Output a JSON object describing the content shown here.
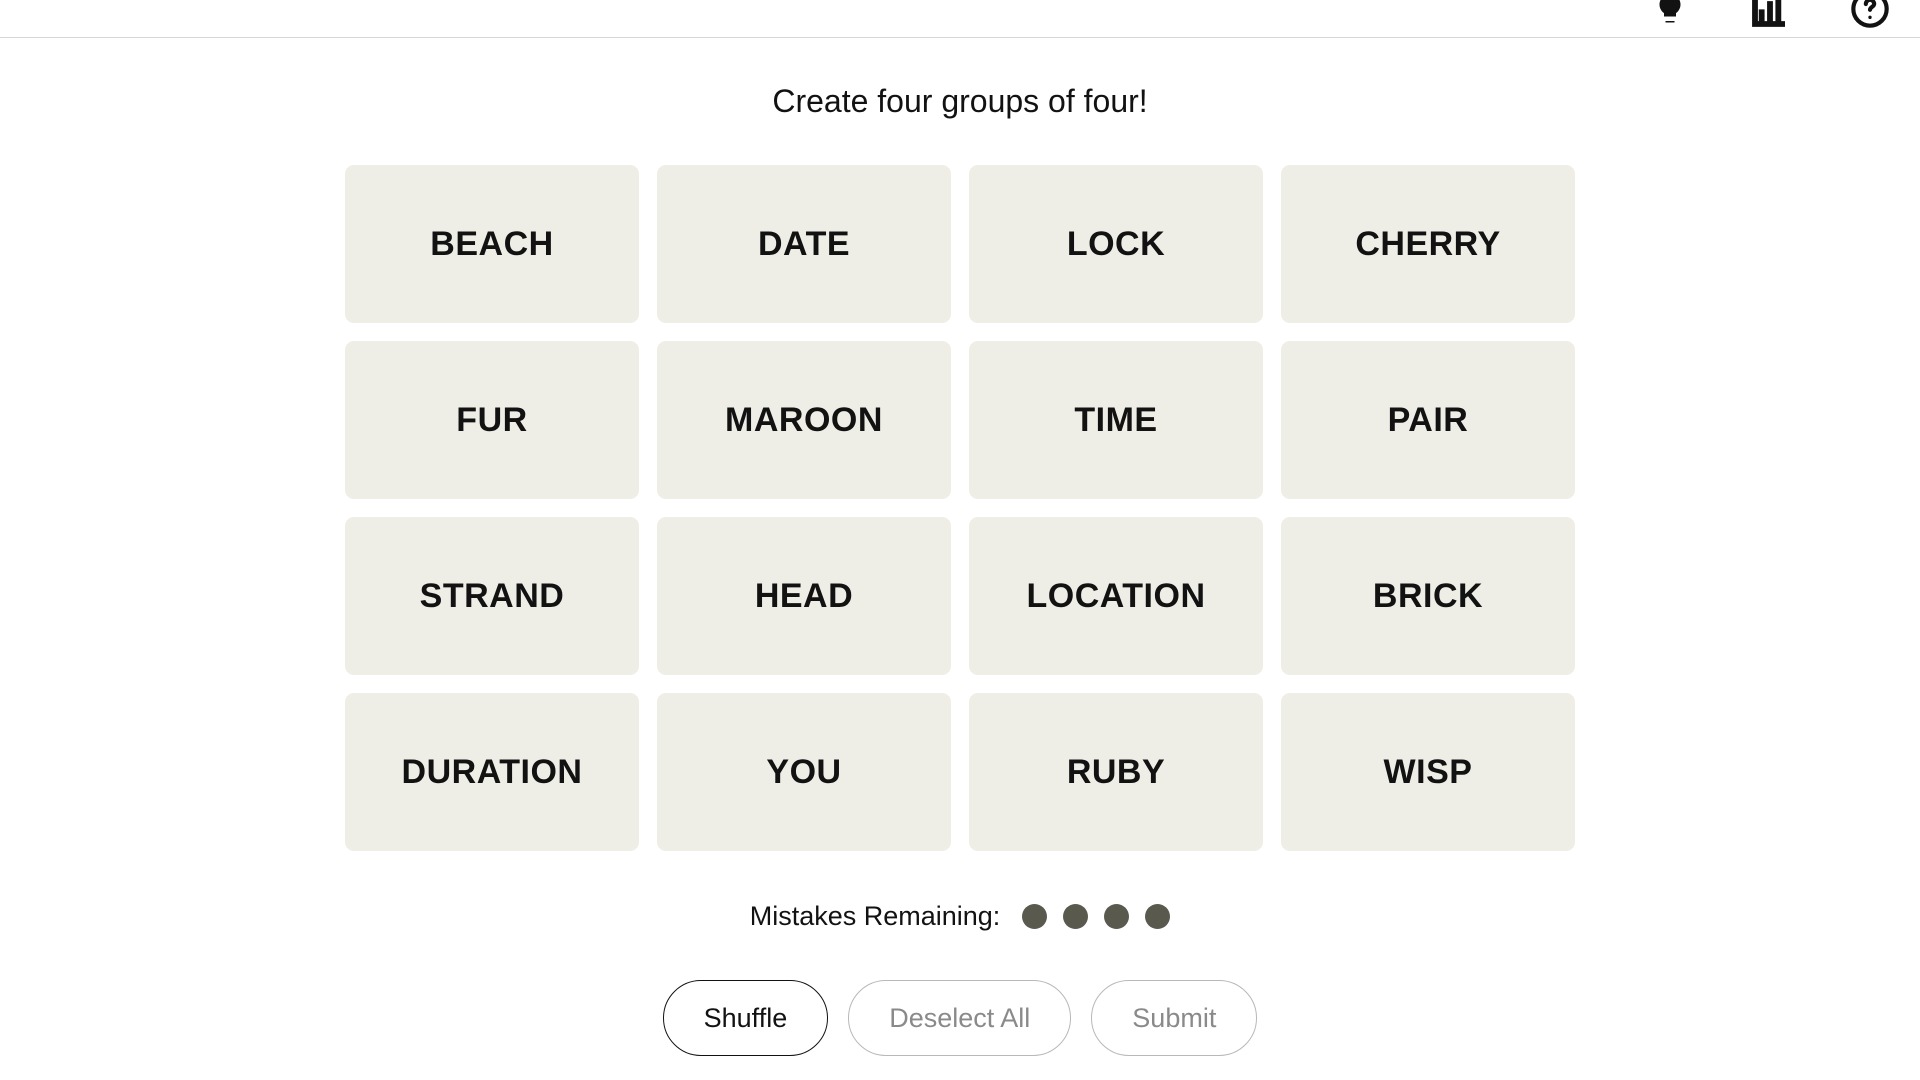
{
  "instruction": "Create four groups of four!",
  "tiles": [
    "BEACH",
    "DATE",
    "LOCK",
    "CHERRY",
    "FUR",
    "MAROON",
    "TIME",
    "PAIR",
    "STRAND",
    "HEAD",
    "LOCATION",
    "BRICK",
    "DURATION",
    "YOU",
    "RUBY",
    "WISP"
  ],
  "mistakes": {
    "label": "Mistakes Remaining:",
    "remaining": 4
  },
  "buttons": {
    "shuffle": "Shuffle",
    "deselect": "Deselect All",
    "submit": "Submit"
  }
}
